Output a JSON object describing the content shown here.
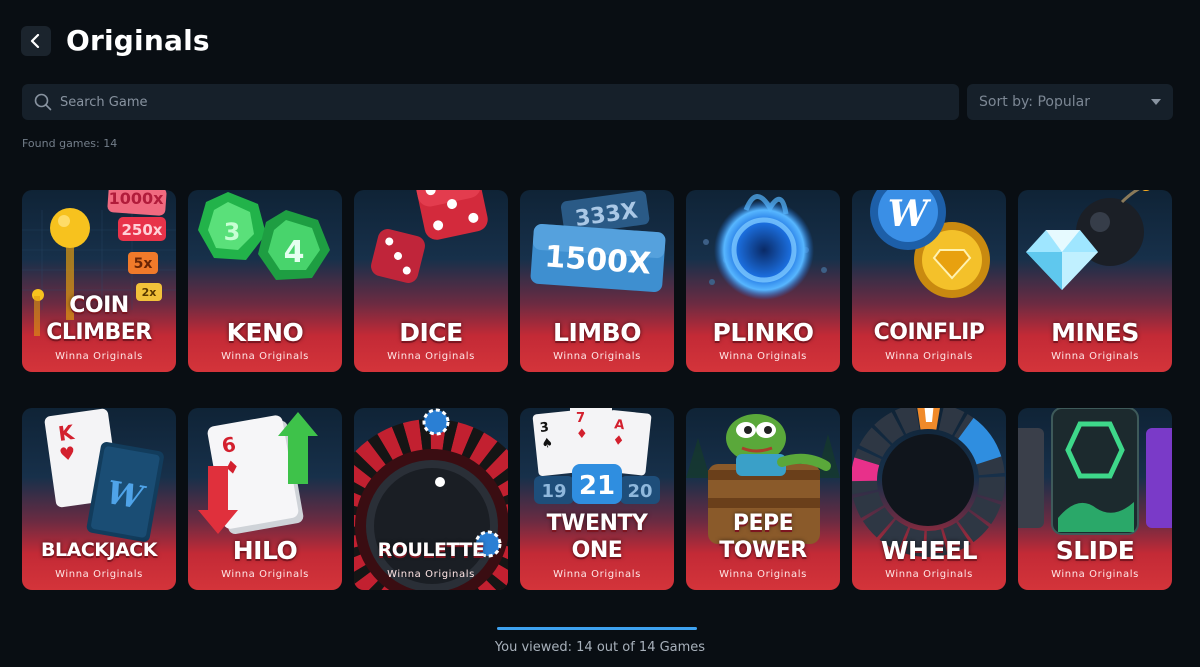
{
  "header": {
    "title": "Originals",
    "back_icon": "chevron-left-icon"
  },
  "search": {
    "placeholder": "Search Game",
    "value": "",
    "icon": "search-icon"
  },
  "sort": {
    "label": "Sort by: Popular",
    "icon": "caret-down-icon"
  },
  "found_games": "Found games: 14",
  "games": [
    {
      "name": "COIN\nCLIMBER",
      "provider": "Winna Originals",
      "art_labels": [
        "1000x",
        "250x",
        "5x",
        "2x"
      ]
    },
    {
      "name": "KENO",
      "provider": "Winna Originals",
      "art_labels": [
        "3",
        "4"
      ]
    },
    {
      "name": "DICE",
      "provider": "Winna Originals"
    },
    {
      "name": "LIMBO",
      "provider": "Winna Originals",
      "art_labels": [
        "333X",
        "1500X"
      ]
    },
    {
      "name": "PLINKO",
      "provider": "Winna Originals"
    },
    {
      "name": "COINFLIP",
      "provider": "Winna Originals"
    },
    {
      "name": "MINES",
      "provider": "Winna Originals"
    },
    {
      "name": "BLACKJACK",
      "provider": "Winna Originals",
      "art_labels": [
        "K"
      ]
    },
    {
      "name": "HILO",
      "provider": "Winna Originals",
      "art_labels": [
        "6"
      ]
    },
    {
      "name": "ROULETTE",
      "provider": "Winna Originals"
    },
    {
      "name": "TWENTY\nONE",
      "provider": "Winna Originals",
      "art_labels": [
        "3",
        "7",
        "A",
        "21",
        "19",
        "20"
      ]
    },
    {
      "name": "PEPE\nTOWER",
      "provider": "Winna Originals"
    },
    {
      "name": "WHEEL",
      "provider": "Winna Originals"
    },
    {
      "name": "SLIDE",
      "provider": "Winna Originals"
    }
  ],
  "progress": {
    "viewed": 14,
    "total": 14,
    "fraction": 1.0,
    "label": "You viewed: 14 out of 14 Games"
  },
  "colors": {
    "background": "#090e13",
    "card_red": "#d4343a",
    "accent_blue": "#3ea2f0"
  }
}
